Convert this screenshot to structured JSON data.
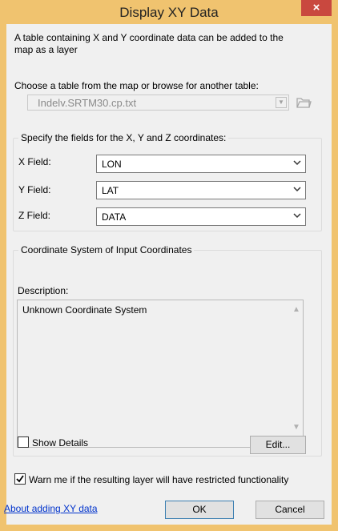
{
  "window": {
    "title": "Display XY Data",
    "close_label": "×"
  },
  "intro_text": "A table containing X and Y coordinate data can be added to the map as a layer",
  "table": {
    "prompt": "Choose a table from the map or browse for another table:",
    "value": "Indelv.SRTM30.cp.txt"
  },
  "fields": {
    "legend": "Specify the fields for the X, Y and Z coordinates:",
    "x": {
      "label": "X Field:",
      "value": "LON"
    },
    "y": {
      "label": "Y Field:",
      "value": "LAT"
    },
    "z": {
      "label": "Z Field:",
      "value": "DATA"
    }
  },
  "coordinate_system": {
    "legend": "Coordinate System of Input Coordinates",
    "description_label": "Description:",
    "description": "Unknown Coordinate System",
    "show_details_label": "Show Details",
    "show_details_checked": false,
    "edit_label": "Edit..."
  },
  "warning": {
    "label": "Warn me if the resulting layer will have restricted functionality",
    "checked": true
  },
  "footer": {
    "help_link": "About adding XY data",
    "ok_label": "OK",
    "cancel_label": "Cancel"
  },
  "colors": {
    "title_bar": "#f0c36f",
    "close_button": "#c9483f",
    "dialog_bg": "#f0f0f0",
    "link": "#0033cc"
  }
}
